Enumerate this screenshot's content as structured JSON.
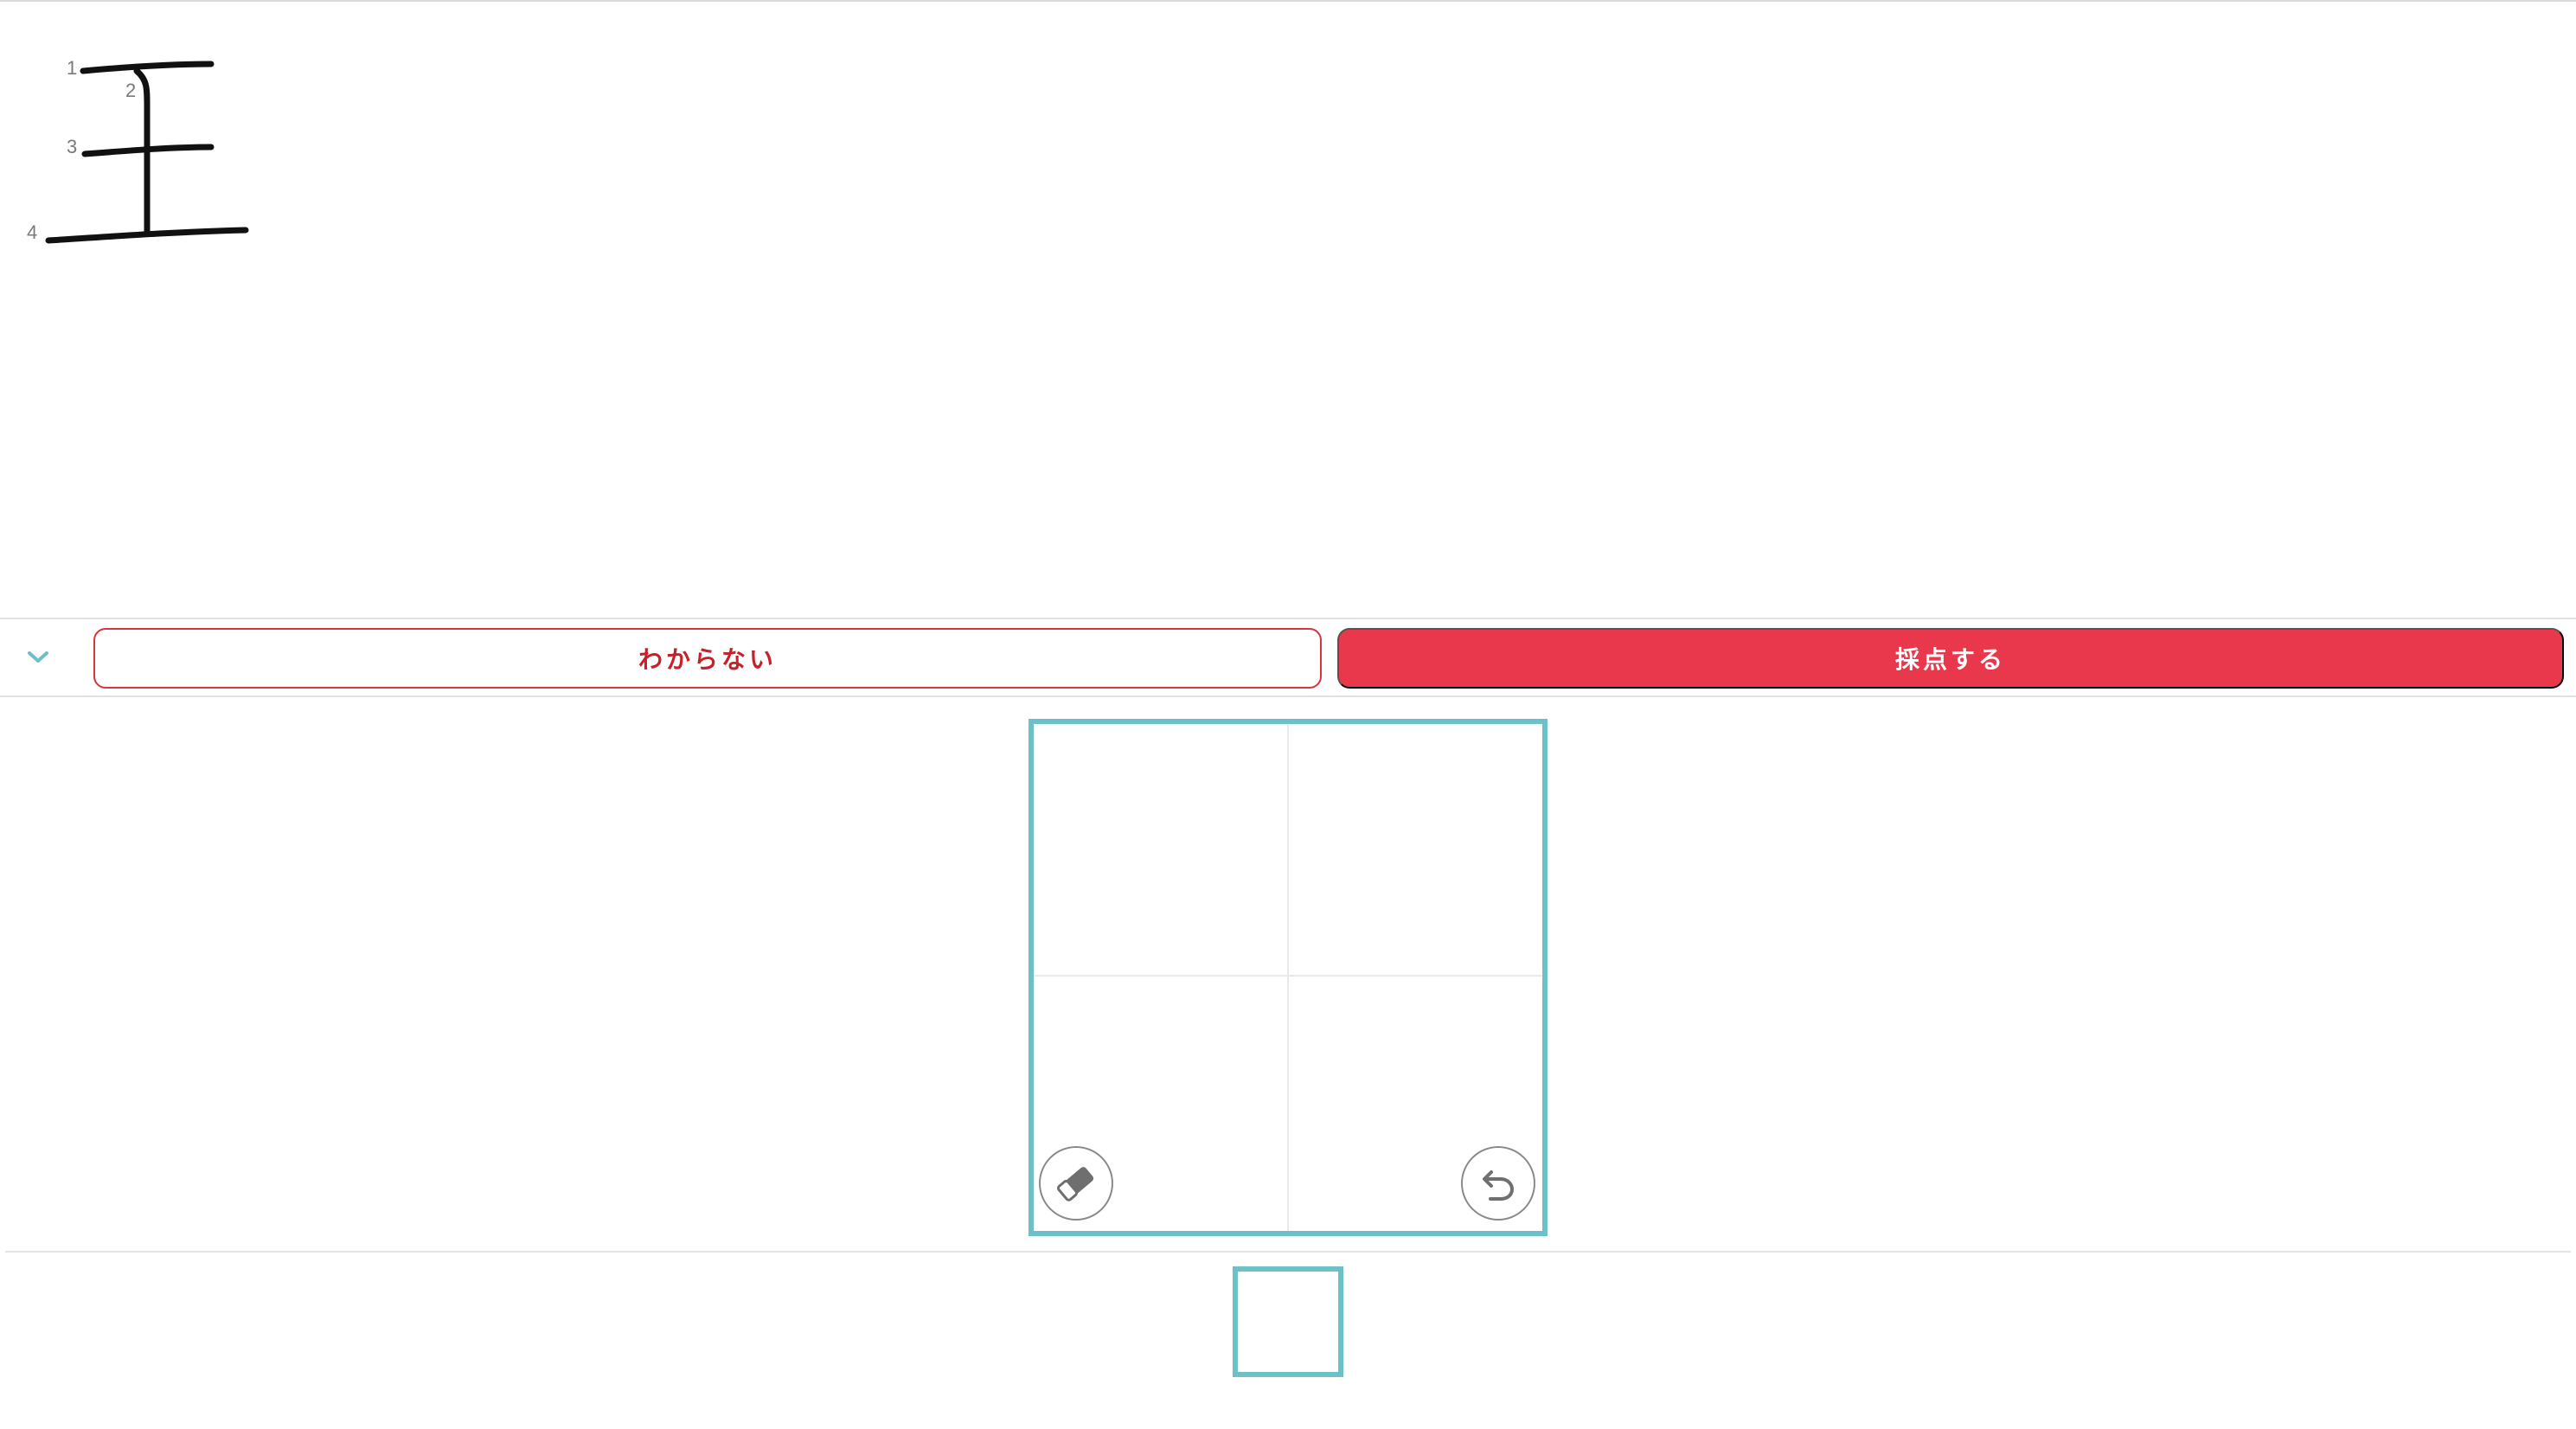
{
  "stroke_order": {
    "kanji": "王",
    "stroke_numbers": [
      "1",
      "2",
      "3",
      "4"
    ]
  },
  "action_bar": {
    "collapse_icon": "chevron-down-icon",
    "dont_know_label": "わからない",
    "grade_label": "採点する"
  },
  "canvas": {
    "eraser_icon": "eraser-icon",
    "undo_icon": "undo-icon"
  },
  "colors": {
    "accent_teal": "#6cc0c8",
    "primary_red": "#e9384b",
    "outline_red": "#d9343f"
  }
}
